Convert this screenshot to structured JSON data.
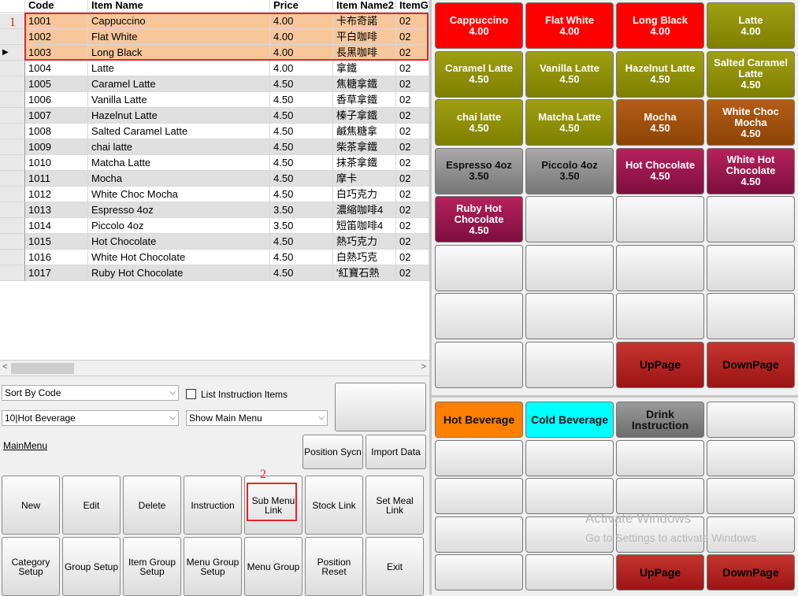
{
  "grid": {
    "headers": [
      "Code",
      "Item Name",
      "Price",
      "Item Name2",
      "ItemG"
    ],
    "rows": [
      {
        "code": "1001",
        "name": "Cappuccino",
        "price": "4.00",
        "name2": "卡布奇諾",
        "group": "02"
      },
      {
        "code": "1002",
        "name": "Flat White",
        "price": "4.00",
        "name2": "平白咖啡",
        "group": "02"
      },
      {
        "code": "1003",
        "name": "Long Black",
        "price": "4.00",
        "name2": "長黑咖啡",
        "group": "02"
      },
      {
        "code": "1004",
        "name": "Latte",
        "price": "4.00",
        "name2": "拿鐵",
        "group": "02"
      },
      {
        "code": "1005",
        "name": "Caramel Latte",
        "price": "4.50",
        "name2": "焦糖拿鐵",
        "group": "02"
      },
      {
        "code": "1006",
        "name": "Vanilla Latte",
        "price": "4.50",
        "name2": "香草拿鐵",
        "group": "02"
      },
      {
        "code": "1007",
        "name": "Hazelnut Latte",
        "price": "4.50",
        "name2": "榛子拿鐵",
        "group": "02"
      },
      {
        "code": "1008",
        "name": "Salted Caramel Latte",
        "price": "4.50",
        "name2": "鹹焦糖拿",
        "group": "02"
      },
      {
        "code": "1009",
        "name": "chai latte",
        "price": "4.50",
        "name2": "柴茶拿鐵",
        "group": "02"
      },
      {
        "code": "1010",
        "name": "Matcha Latte",
        "price": "4.50",
        "name2": "抹茶拿鐵",
        "group": "02"
      },
      {
        "code": "1011",
        "name": "Mocha",
        "price": "4.50",
        "name2": "摩卡",
        "group": "02"
      },
      {
        "code": "1012",
        "name": "White Choc Mocha",
        "price": "4.50",
        "name2": "白巧克力",
        "group": "02"
      },
      {
        "code": "1013",
        "name": "Espresso 4oz",
        "price": "3.50",
        "name2": "濃縮咖啡4",
        "group": "02"
      },
      {
        "code": "1014",
        "name": "Piccolo 4oz",
        "price": "3.50",
        "name2": "短笛咖啡4",
        "group": "02"
      },
      {
        "code": "1015",
        "name": "Hot Chocolate",
        "price": "4.50",
        "name2": "熱巧克力",
        "group": "02"
      },
      {
        "code": "1016",
        "name": "White Hot Chocolate",
        "price": "4.50",
        "name2": "白熱巧克",
        "group": "02"
      },
      {
        "code": "1017",
        "name": "Ruby Hot Chocolate",
        "price": "4.50",
        "name2": "'紅寶石熱",
        "group": "02"
      }
    ]
  },
  "annotations": {
    "box1": "1",
    "box2": "2"
  },
  "controls": {
    "sort_select": "Sort By Code",
    "list_instruction_label": "List Instruction Items",
    "category_select": "10|Hot Beverage",
    "menu_select": "Show Main Menu",
    "main_menu_link": "MainMenu",
    "position_sync": "Position Sycn",
    "import_data": "Import Data"
  },
  "buttons_row1": [
    "New",
    "Edit",
    "Delete",
    "Instruction",
    "Sub Menu Link",
    "Stock Link",
    "Set Meal Link"
  ],
  "buttons_row2": [
    "Category Setup",
    "Group Setup",
    "Item Group Setup",
    "Menu Group Setup",
    "Menu Group",
    "Position Reset",
    "Exit"
  ],
  "menu_tiles": [
    {
      "name": "Cappuccino",
      "price": "4.00",
      "color": "#ff0000"
    },
    {
      "name": "Flat White",
      "price": "4.00",
      "color": "#ff0000"
    },
    {
      "name": "Long Black",
      "price": "4.00",
      "color": "#ff0000"
    },
    {
      "name": "Latte",
      "price": "4.00",
      "color": "#8f8f0a"
    },
    {
      "name": "Caramel Latte",
      "price": "4.50",
      "color": "#8f8f0a"
    },
    {
      "name": "Vanilla Latte",
      "price": "4.50",
      "color": "#8f8f0a"
    },
    {
      "name": "Hazelnut Latte",
      "price": "4.50",
      "color": "#8f8f0a"
    },
    {
      "name": "Salted Caramel Latte",
      "price": "4.50",
      "color": "#8f8f0a"
    },
    {
      "name": "chai latte",
      "price": "4.50",
      "color": "#8f8f0a"
    },
    {
      "name": "Matcha Latte",
      "price": "4.50",
      "color": "#8f8f0a"
    },
    {
      "name": "Mocha",
      "price": "4.50",
      "color": "#a0500e"
    },
    {
      "name": "White Choc Mocha",
      "price": "4.50",
      "color": "#a0500e"
    },
    {
      "name": "Espresso 4oz",
      "price": "3.50",
      "color": "#8f8f8f"
    },
    {
      "name": "Piccolo 4oz",
      "price": "3.50",
      "color": "#8f8f8f"
    },
    {
      "name": "Hot Chocolate",
      "price": "4.50",
      "color": "#9a1a4c"
    },
    {
      "name": "White Hot Chocolate",
      "price": "4.50",
      "color": "#9a1a4c"
    },
    {
      "name": "Ruby Hot Chocolate",
      "price": "4.50",
      "color": "#9a1a4c"
    }
  ],
  "paging": {
    "up": "UpPage",
    "down": "DownPage"
  },
  "groups": [
    {
      "name": "Hot Beverage",
      "color": "#ff8000"
    },
    {
      "name": "Cold Beverage",
      "color": "#00ffff"
    },
    {
      "name": "Drink Instruction",
      "color": "#8a8a8a"
    }
  ],
  "watermark": {
    "title": "Activate Windows",
    "sub": "Go to Settings to activate Windows."
  }
}
